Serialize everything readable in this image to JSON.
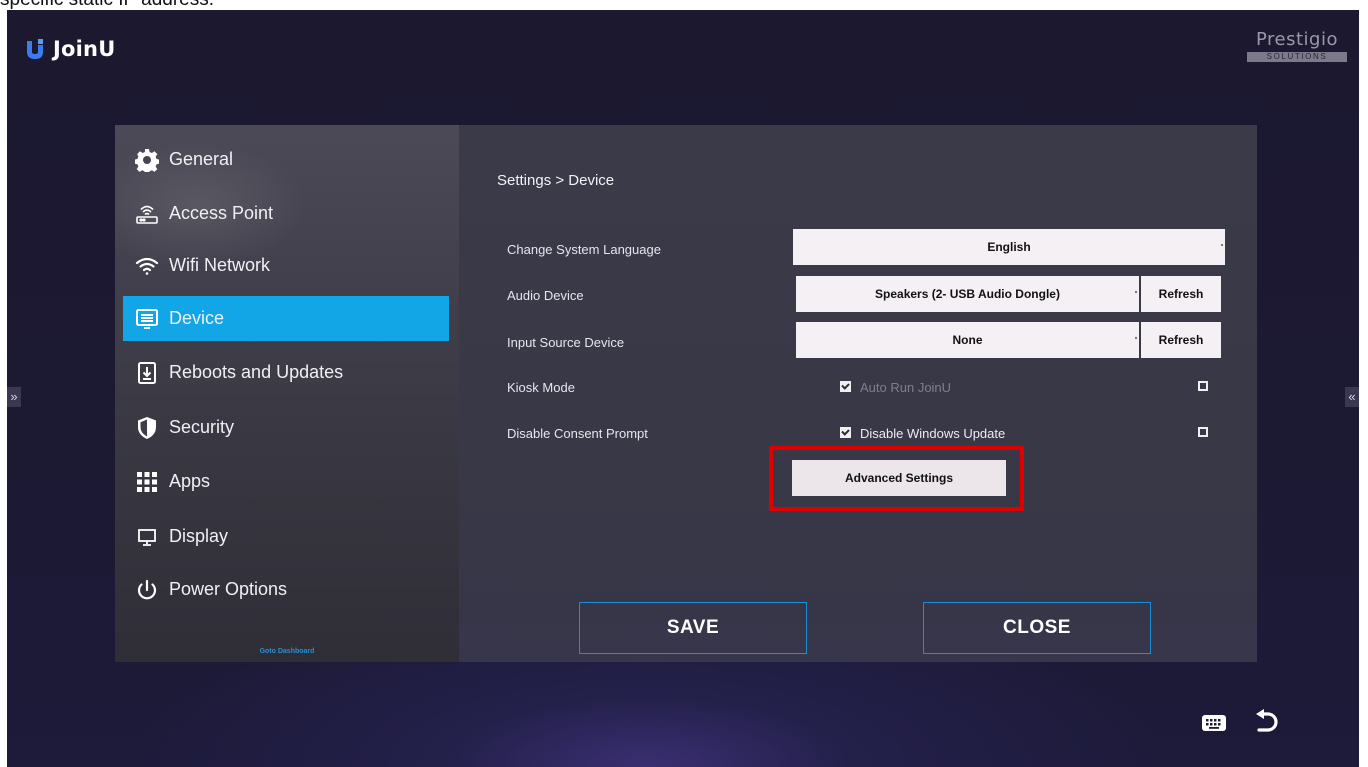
{
  "caption": "specific static IP address.",
  "app": {
    "name": "JoinU"
  },
  "brand": {
    "name": "Prestigio",
    "sub": "SOLUTIONS"
  },
  "edge_arrows": {
    "left": "»",
    "right": "«"
  },
  "sidebar": {
    "items": [
      {
        "label": "General",
        "icon": "gear-icon"
      },
      {
        "label": "Access Point",
        "icon": "router-icon"
      },
      {
        "label": "Wifi Network",
        "icon": "wifi-icon"
      },
      {
        "label": "Device",
        "icon": "monitor-icon",
        "active": true
      },
      {
        "label": "Reboots and Updates",
        "icon": "download-icon"
      },
      {
        "label": "Security",
        "icon": "shield-icon"
      },
      {
        "label": "Apps",
        "icon": "apps-grid-icon"
      },
      {
        "label": "Display",
        "icon": "display-icon"
      },
      {
        "label": "Power Options",
        "icon": "power-icon"
      }
    ],
    "goto_dashboard": "Goto Dashboard"
  },
  "content": {
    "breadcrumb": "Settings > Device",
    "language": {
      "label": "Change System Language",
      "value": "English"
    },
    "audio": {
      "label": "Audio Device",
      "value": "Speakers (2- USB Audio Dongle)",
      "refresh": "Refresh"
    },
    "input_source": {
      "label": "Input Source Device",
      "value": "None",
      "refresh": "Refresh"
    },
    "kiosk": {
      "label": "Kiosk Mode",
      "checked": true
    },
    "auto_run": {
      "label": "Auto Run JoinU",
      "checked": false
    },
    "consent": {
      "label": "Disable Consent Prompt",
      "checked": true
    },
    "windows_update": {
      "label": "Disable Windows Update",
      "checked": false
    },
    "advanced": "Advanced Settings",
    "save": "SAVE",
    "close": "CLOSE"
  },
  "colors": {
    "accent": "#12a6e6",
    "highlight": "#e00000",
    "button_border": "#1c8ed6"
  }
}
